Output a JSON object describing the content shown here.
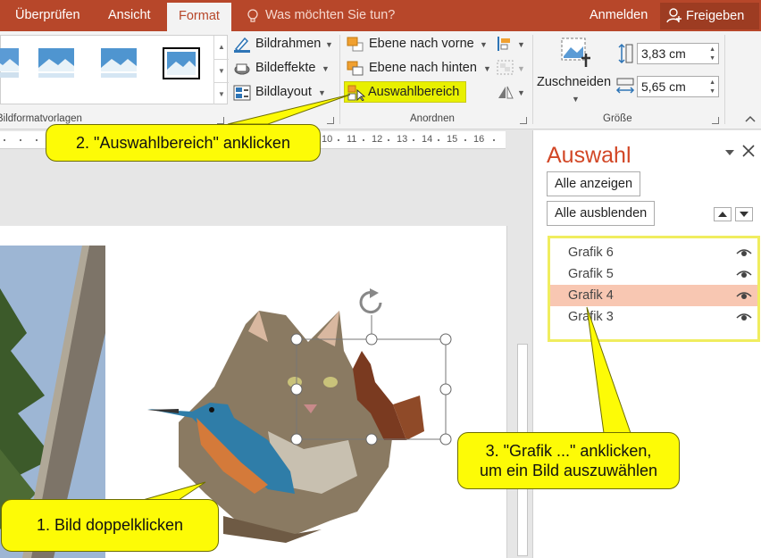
{
  "tabs": [
    {
      "label": "Überprüfen",
      "active": false
    },
    {
      "label": "Ansicht",
      "active": false
    },
    {
      "label": "Format",
      "active": true
    }
  ],
  "tell_me": "Was möchten Sie tun?",
  "sign_in": "Anmelden",
  "share": "Freigeben",
  "ribbon": {
    "styles_group_label": "Bildformatvorlagen",
    "bild_buttons": [
      "Bildrahmen",
      "Bildeffekte",
      "Bildlayout"
    ],
    "arrange_buttons": [
      "Ebene nach vorne",
      "Ebene nach hinten",
      "Auswahlbereich"
    ],
    "arrange_group_label": "Anordnen",
    "crop_label": "Zuschneiden",
    "height_value": "3,83  cm",
    "width_value": "5,65  cm",
    "size_group_label": "Größe"
  },
  "ruler_numbers": [
    "10",
    "11",
    "12",
    "13",
    "14",
    "15",
    "16"
  ],
  "selection_pane": {
    "title": "Auswahl",
    "show_all": "Alle anzeigen",
    "hide_all": "Alle ausblenden",
    "items": [
      {
        "label": "Grafik 6",
        "selected": false
      },
      {
        "label": "Grafik 5",
        "selected": false
      },
      {
        "label": "Grafik 4",
        "selected": true
      },
      {
        "label": "Grafik 3",
        "selected": false
      }
    ]
  },
  "callouts": {
    "step1": "1. Bild doppelklicken",
    "step2": "2. \"Auswahlbereich\" anklicken",
    "step3_line1": "3. \"Grafik ...\" anklicken,",
    "step3_line2": "um ein Bild auszuwählen"
  },
  "colors": {
    "accent": "#b7472a",
    "pane_title": "#d24726",
    "highlight": "#fdfb06",
    "selected_row": "#f8c7b2"
  }
}
